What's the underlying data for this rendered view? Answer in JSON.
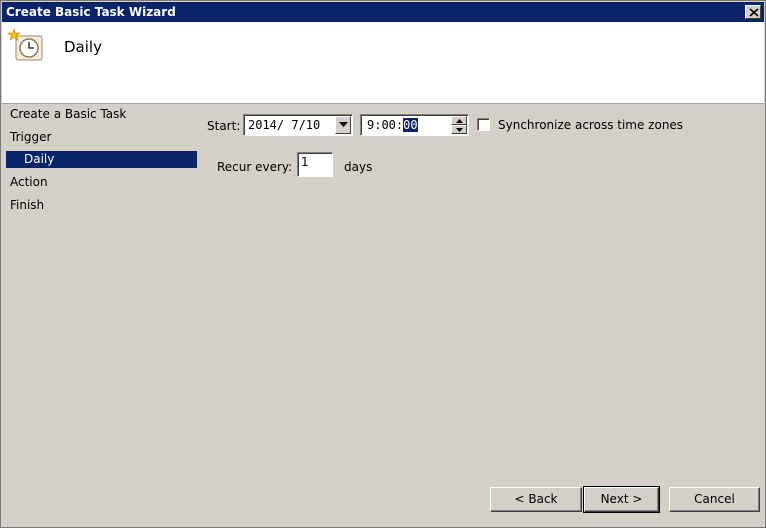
{
  "window": {
    "title": "Create Basic Task Wizard"
  },
  "header": {
    "title": "Daily"
  },
  "nav": {
    "items": [
      {
        "label": "Create a Basic Task"
      },
      {
        "label": "Trigger"
      },
      {
        "label": "Daily",
        "selected": true
      },
      {
        "label": "Action"
      },
      {
        "label": "Finish"
      }
    ]
  },
  "form": {
    "start_label": "Start:",
    "start_date": "2014/ 7/10",
    "start_time_prefix": "9:00:",
    "start_time_selected": "00",
    "sync_label": "Synchronize across time zones",
    "sync_checked": false,
    "recur_label": "Recur every:",
    "recur_value": "1",
    "recur_unit": "days"
  },
  "buttons": {
    "back": "< Back",
    "next": "Next >",
    "cancel": "Cancel"
  },
  "colors": {
    "titlebar": "#0a246a",
    "selection": "#0a246a",
    "face": "#d4d0c8"
  }
}
